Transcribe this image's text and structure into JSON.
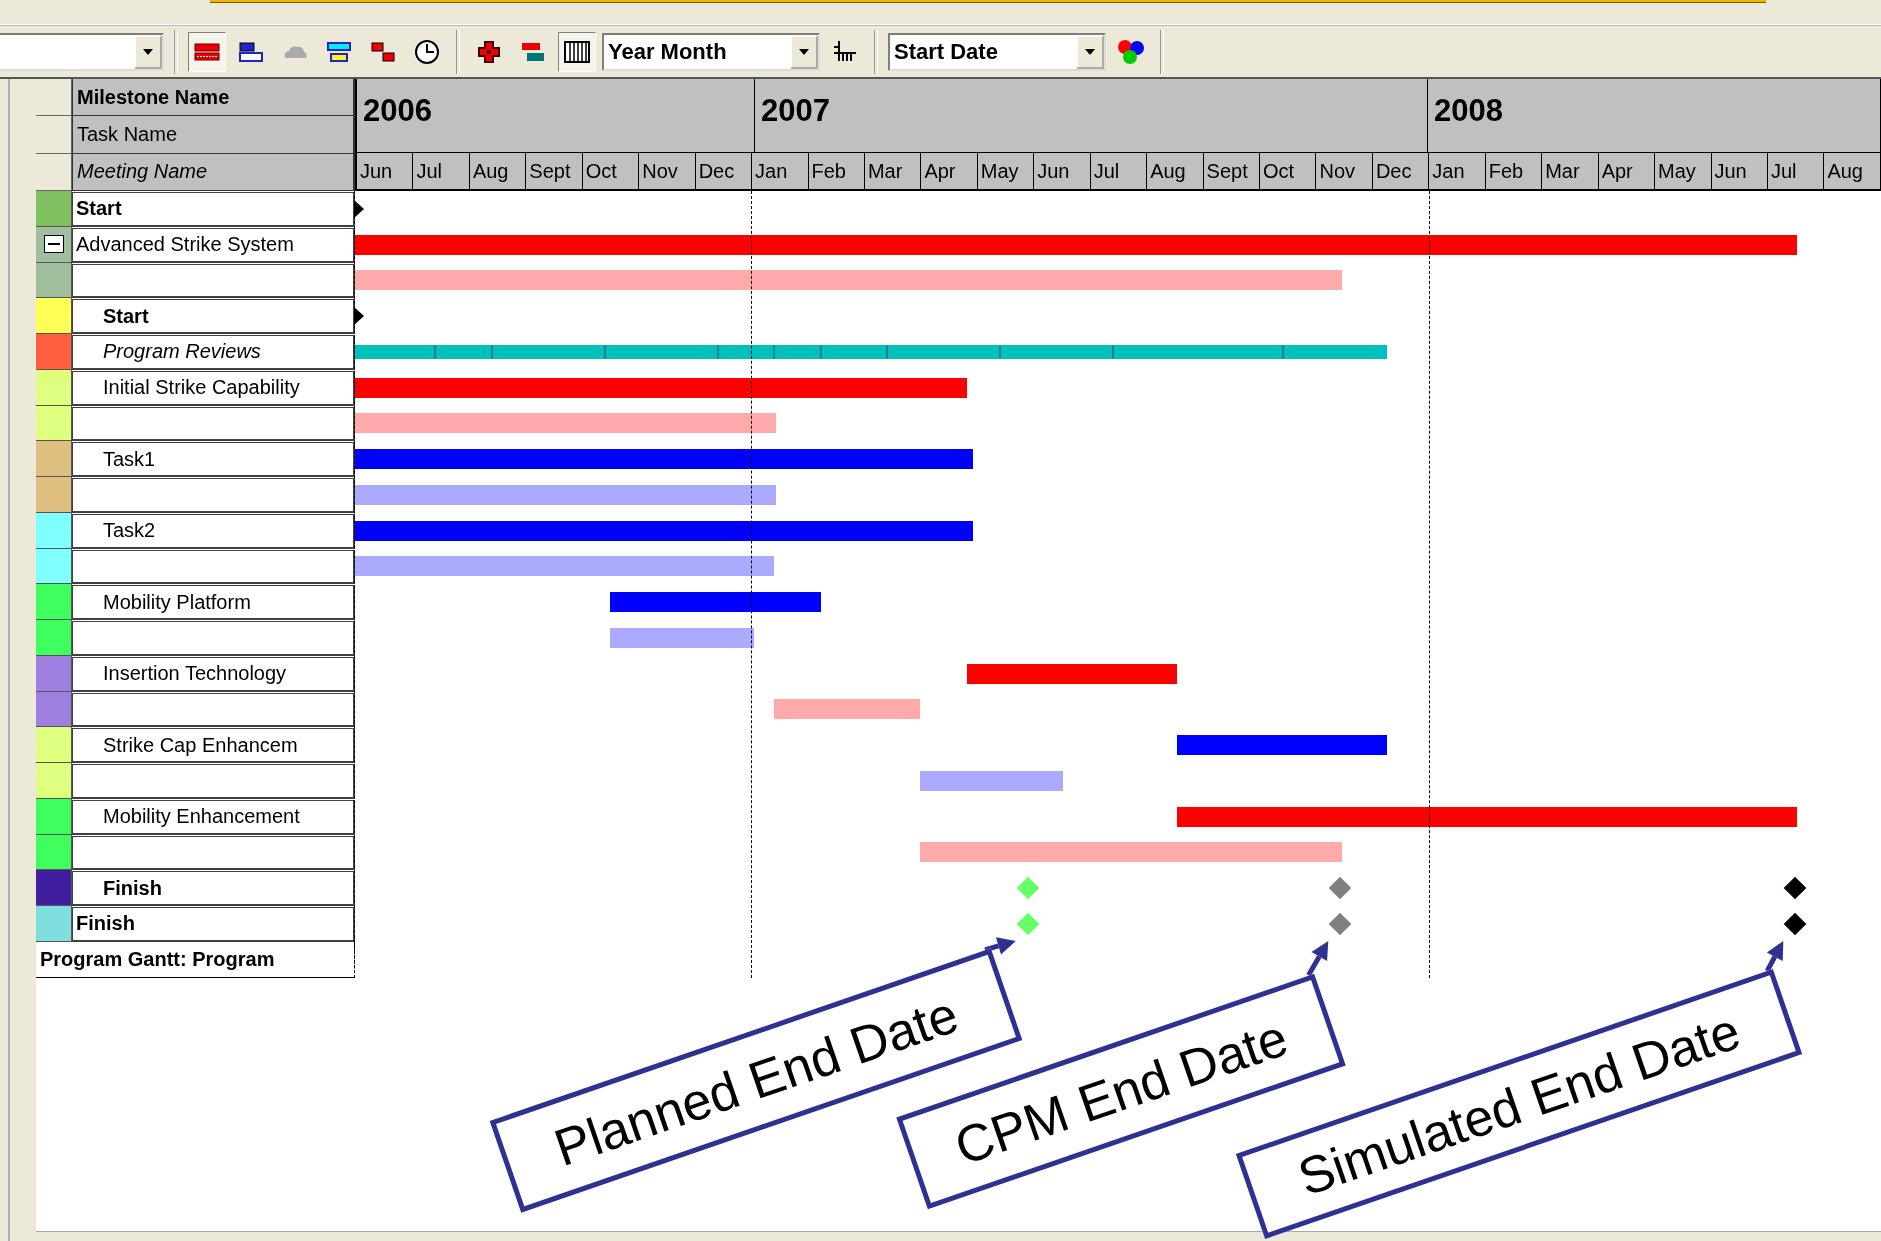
{
  "toolbar": [
    {
      "kind": "combo"
    },
    {
      "kind": "separator"
    },
    {
      "kind": "tool",
      "pressed": true
    },
    {
      "kind": "tool",
      "pressed": false
    },
    {
      "kind": "tool",
      "pressed": false
    },
    {
      "kind": "tool",
      "pressed": false
    },
    {
      "kind": "tool",
      "pressed": false
    },
    {
      "kind": "tool",
      "pressed": false
    },
    {
      "kind": "separator"
    },
    {
      "kind": "tool",
      "pressed": false
    },
    {
      "kind": "tool",
      "pressed": false
    },
    {
      "kind": "tool",
      "pressed": true
    },
    {
      "kind": "combo",
      "value": "Year Month"
    },
    {
      "kind": "tool",
      "pressed": false
    },
    {
      "kind": "separator"
    },
    {
      "kind": "combo",
      "value": "Start Date"
    },
    {
      "kind": "tool",
      "pressed": false
    },
    {
      "kind": "separator"
    }
  ],
  "headers": [
    {
      "kind": "milestone",
      "label": "Milestone Name"
    },
    {
      "kind": "task",
      "label": "Task Name"
    },
    {
      "kind": "meeting",
      "label": "Meeting Name"
    }
  ],
  "timeline": {
    "years": [
      {
        "label": "2006",
        "months": [
          "Jun",
          "Jul",
          "Aug",
          "Sept",
          "Oct",
          "Nov",
          "Dec"
        ]
      },
      {
        "label": "2007",
        "months": [
          "Jan",
          "Feb",
          "Mar",
          "Apr",
          "May",
          "Jun",
          "Jul",
          "Aug",
          "Sept",
          "Oct",
          "Nov",
          "Dec"
        ]
      },
      {
        "label": "2008",
        "months": [
          "Jan",
          "Feb",
          "Mar",
          "Apr",
          "May",
          "Jun",
          "Jul",
          "Aug"
        ]
      }
    ]
  },
  "items": [
    {
      "kind": "milestone",
      "label": "Start",
      "color": "#7fbf5f"
    },
    {
      "kind": "task",
      "label": "Advanced Strike System",
      "color": "#9fbf9f",
      "expanded": true,
      "actual": {
        "color": "#ff0000"
      },
      "planned": {
        "color": "#ffaaaa"
      },
      "children": [
        {
          "kind": "milestone",
          "label": "Start",
          "color": "#ffff55"
        },
        {
          "kind": "meeting",
          "label": "Program Reviews",
          "color": "#ff5f3f",
          "bar": {
            "color": "#00bfbf"
          }
        },
        {
          "kind": "task",
          "label": "Initial Strike Capability",
          "color": "#dfff7f",
          "actual": {
            "color": "#ff0000"
          },
          "planned": {
            "color": "#ffaaaa"
          }
        },
        {
          "kind": "task",
          "label": "Task1",
          "color": "#dfbf7f",
          "actual": {
            "color": "#0000ff"
          },
          "planned": {
            "color": "#aaaaff"
          }
        },
        {
          "kind": "task",
          "label": "Task2",
          "color": "#7fffff",
          "actual": {
            "color": "#0000ff"
          },
          "planned": {
            "color": "#aaaaff"
          }
        },
        {
          "kind": "task",
          "label": "Mobility Platform",
          "color": "#3fff5f",
          "actual": {
            "color": "#0000ff"
          },
          "planned": {
            "color": "#aaaaff"
          }
        },
        {
          "kind": "task",
          "label": "Insertion Technology",
          "color": "#9f7fdf",
          "actual": {
            "color": "#ff0000"
          },
          "planned": {
            "color": "#ffaaaa"
          }
        },
        {
          "kind": "task",
          "label": "Strike Cap Enhancem",
          "color": "#dfff7f",
          "actual": {
            "color": "#0000ff"
          },
          "planned": {
            "color": "#aaaaff"
          }
        },
        {
          "kind": "task",
          "label": "Mobility Enhancement",
          "color": "#3fff5f",
          "actual": {
            "color": "#ff0000"
          },
          "planned": {
            "color": "#ffaaaa"
          }
        },
        {
          "kind": "finish",
          "label": "Finish",
          "color": "#3f1f9f",
          "diamonds": [
            {
              "color": "#66ff66"
            },
            {
              "color": "#808080"
            },
            {
              "color": "#000000"
            }
          ]
        }
      ]
    },
    {
      "kind": "finish",
      "label": "Finish",
      "color": "#7fdfdf",
      "diamonds": [
        {
          "color": "#66ff66"
        },
        {
          "color": "#808080"
        },
        {
          "color": "#000000"
        }
      ]
    }
  ],
  "footer": "Program Gantt: Program",
  "callouts": [
    {
      "label": "Planned End Date"
    },
    {
      "label": "CPM End Date"
    },
    {
      "label": "Simulated End Date"
    }
  ]
}
